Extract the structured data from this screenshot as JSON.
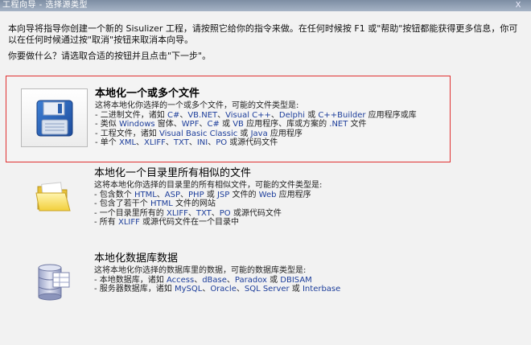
{
  "window": {
    "title": "工程向导 - 选择源类型",
    "close_glyph": "X"
  },
  "intro": "本向导将指导你创建一个新的 Sisulizer 工程，请按照它给你的指令来做。在任何时候按 F1 或\"帮助\"按钮都能获得更多信息，你可以在任何时候通过按\"取消\"按钮来取消本向导。",
  "prompt": "你要做什么？请选取合适的按钮并且点击\"下一步\"。",
  "options": [
    {
      "title": "本地化一个或多个文件",
      "desc": "这将本地化你选择的一个或多个文件，可能的文件类型是:",
      "lines": [
        [
          "- 二进制文件，诸如 ",
          "C#",
          "、",
          "VB.NET",
          "、",
          "Visual C++",
          "、",
          "Delphi",
          " 或 ",
          "C++Builder",
          " 应用程序或库"
        ],
        [
          "- 类似 ",
          "Windows",
          " 窗体、",
          "WPF",
          "、",
          "C#",
          " 或 ",
          "VB",
          " 应用程序、库或方案的 ",
          ".NET",
          " 文件"
        ],
        [
          "- 工程文件，诸如 ",
          "Visual Basic Classic",
          " 或 ",
          "Java",
          " 应用程序"
        ],
        [
          "- 单个 ",
          "XML",
          "、",
          "XLIFF",
          "、",
          "TXT",
          "、",
          "INI",
          "、",
          "PO",
          " 或源代码文件"
        ]
      ],
      "icon": "floppy-disk-icon"
    },
    {
      "title": "本地化一个目录里所有相似的文件",
      "desc": "这将本地化你选择的目录里的所有相似文件，可能的文件类型是:",
      "lines": [
        [
          "- 包含数个 ",
          "HTML",
          "、",
          "ASP",
          "、",
          "PHP",
          " 或 ",
          "JSP",
          " 文件的 ",
          "Web",
          " 应用程序"
        ],
        [
          "- 包含了若干个 ",
          "HTML",
          " 文件的网站"
        ],
        [
          "- 一个目录里所有的 ",
          "XLIFF",
          "、",
          "TXT",
          "、",
          "PO",
          " 或源代码文件"
        ],
        [
          "- 所有 ",
          "XLIFF",
          " 或源代码文件在一个目录中"
        ]
      ],
      "icon": "folder-icon"
    },
    {
      "title": "本地化数据库数据",
      "desc": "这将本地化你选择的数据库里的数据，可能的数据库类型是:",
      "lines": [
        [
          "- 本地数据库，诸如 ",
          "Access",
          "、",
          "dBase",
          "、",
          "Paradox",
          " 或 ",
          "DBISAM"
        ],
        [
          "- 服务器数据库，诸如 ",
          "MySQL",
          "、",
          "Oracle",
          "、",
          "SQL Server",
          " 或 ",
          "Interbase"
        ]
      ],
      "icon": "database-icon"
    }
  ],
  "colors": {
    "selection_border": "#e03030",
    "highlight_text": "#1d3e9b"
  }
}
